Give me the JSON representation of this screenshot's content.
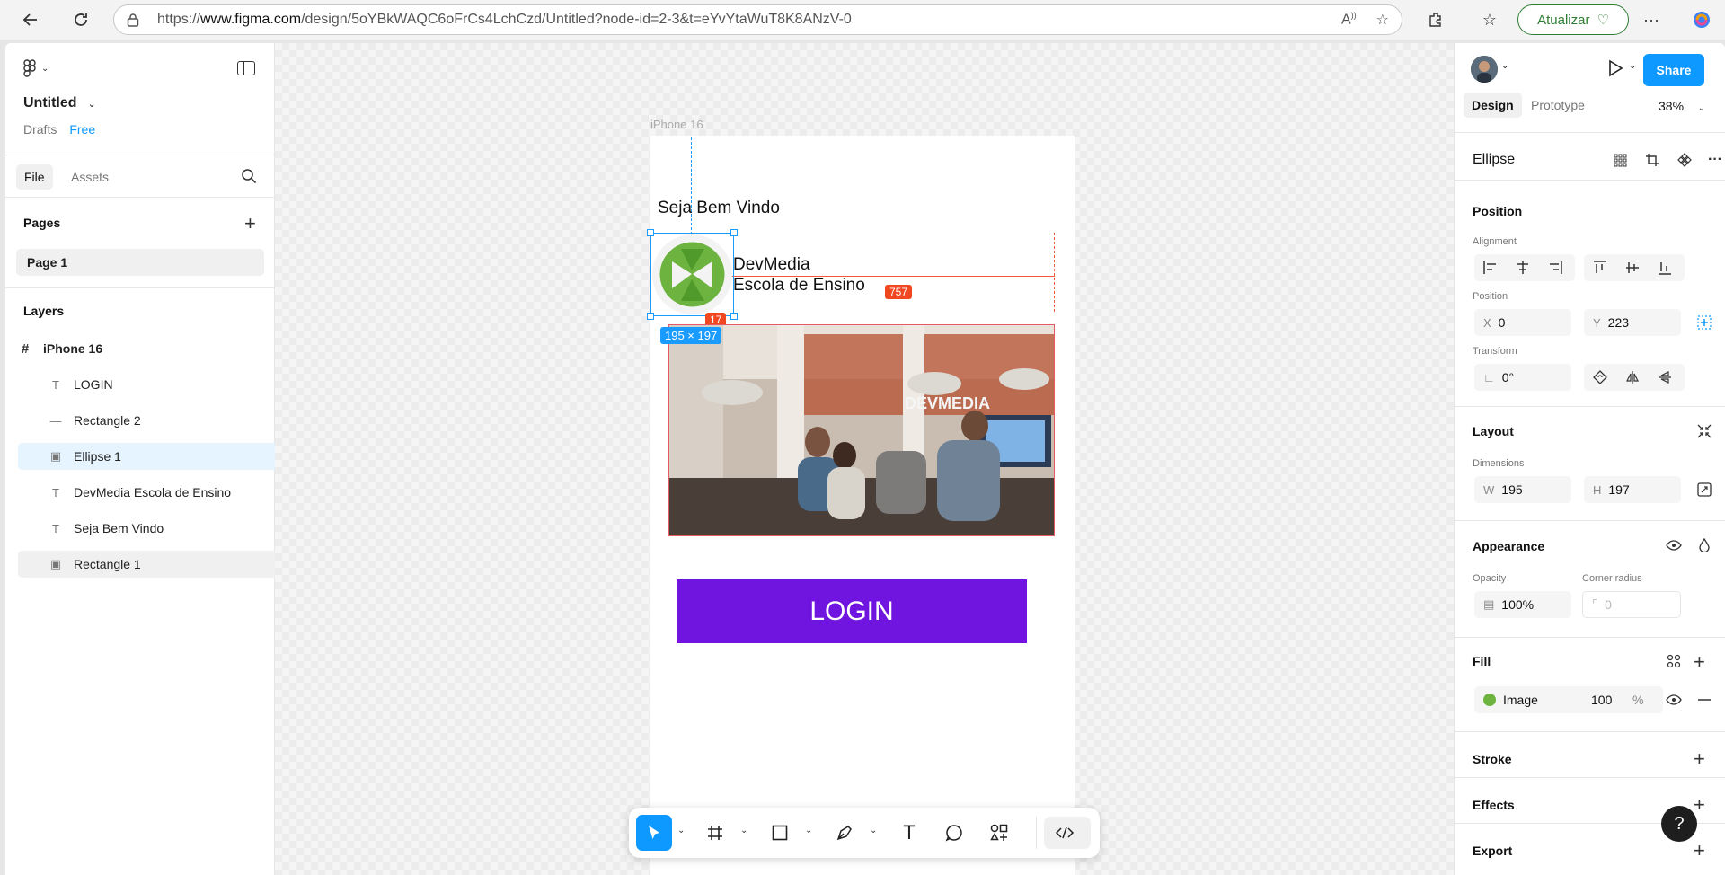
{
  "browser": {
    "url_prefix": "https://",
    "url_host": "www.figma.com",
    "url_path": "/design/5oYBkWAQC6oFrCs4LchCzd/Untitled?node-id=2-3&t=eYvYtaWuT8K8ANzV-0",
    "update_label": "Atualizar"
  },
  "file": {
    "title": "Untitled",
    "location": "Drafts",
    "plan": "Free"
  },
  "left_tabs": {
    "file": "File",
    "assets": "Assets"
  },
  "pages": {
    "heading": "Pages",
    "items": [
      {
        "label": "Page 1"
      }
    ]
  },
  "layers": {
    "heading": "Layers",
    "frame": "iPhone 16",
    "items": [
      {
        "label": "LOGIN",
        "icon": "text-icon"
      },
      {
        "label": "Rectangle 2",
        "icon": "line-icon"
      },
      {
        "label": "Ellipse 1",
        "icon": "image-icon"
      },
      {
        "label": "DevMedia Escola de Ensino",
        "icon": "text-icon"
      },
      {
        "label": "Seja Bem Vindo",
        "icon": "text-icon"
      },
      {
        "label": "Rectangle 1",
        "icon": "image-icon"
      }
    ]
  },
  "canvas": {
    "frame_label": "iPhone 16",
    "welcome": "Seja Bem Vindo",
    "brand_line1": "DevMedia",
    "brand_line2": "Escola de Ensino",
    "measure_h": "757",
    "measure_v": "17",
    "size_badge": "195 × 197",
    "login": "LOGIN"
  },
  "right": {
    "share": "Share",
    "tabs": {
      "design": "Design",
      "prototype": "Prototype"
    },
    "zoom": "38%",
    "selection": "Ellipse",
    "position": {
      "heading": "Position",
      "alignment_label": "Alignment",
      "position_label": "Position",
      "x_prefix": "X",
      "x": "0",
      "y_prefix": "Y",
      "y": "223",
      "transform_label": "Transform",
      "rotation": "0°"
    },
    "layout": {
      "heading": "Layout",
      "dimensions_label": "Dimensions",
      "w_prefix": "W",
      "w": "195",
      "h_prefix": "H",
      "h": "197"
    },
    "appearance": {
      "heading": "Appearance",
      "opacity_label": "Opacity",
      "opacity": "100%",
      "radius_label": "Corner radius",
      "radius": "0"
    },
    "fill": {
      "heading": "Fill",
      "type": "Image",
      "opacity": "100",
      "unit": "%"
    },
    "stroke": "Stroke",
    "effects": "Effects",
    "export": "Export",
    "help": "?"
  },
  "colors": {
    "accent": "#0d99ff",
    "login_button": "#7015e0",
    "measure": "#f24822",
    "brand_green": "#6db33f"
  }
}
